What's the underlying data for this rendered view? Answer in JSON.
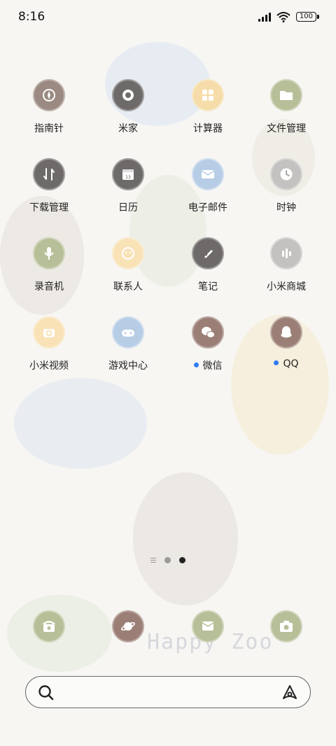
{
  "status_bar": {
    "time": "8:16",
    "battery": "100"
  },
  "apps": [
    {
      "label": "指南针",
      "icon": "compass-icon",
      "color": "#9b8a82"
    },
    {
      "label": "米家",
      "icon": "mijia-icon",
      "color": "#6e6a69"
    },
    {
      "label": "计算器",
      "icon": "calculator-icon",
      "color": "#f5dca8"
    },
    {
      "label": "文件管理",
      "icon": "folder-icon",
      "color": "#b7bf98"
    },
    {
      "label": "下载管理",
      "icon": "download-icon",
      "color": "#6e6a69"
    },
    {
      "label": "日历",
      "icon": "calendar-icon",
      "color": "#6e6a69",
      "calendar_day": "13"
    },
    {
      "label": "电子邮件",
      "icon": "mail-icon",
      "color": "#b7cde6"
    },
    {
      "label": "时钟",
      "icon": "clock-icon",
      "color": "#c4c2c0"
    },
    {
      "label": "录音机",
      "icon": "microphone-icon",
      "color": "#b7bf98"
    },
    {
      "label": "联系人",
      "icon": "contacts-icon",
      "color": "#f8e2b6"
    },
    {
      "label": "笔记",
      "icon": "notes-icon",
      "color": "#6e6a69"
    },
    {
      "label": "小米商城",
      "icon": "store-icon",
      "color": "#c4c2c0"
    },
    {
      "label": "小米视频",
      "icon": "video-icon",
      "color": "#f8e2b6"
    },
    {
      "label": "游戏中心",
      "icon": "gamepad-icon",
      "color": "#b7cde6"
    },
    {
      "label": "微信",
      "icon": "wechat-icon",
      "color": "#9b7f76",
      "new_dot": true
    },
    {
      "label": "QQ",
      "icon": "qq-icon",
      "color": "#9b7f76",
      "new_dot": true
    }
  ],
  "dock": [
    {
      "name": "phone",
      "icon": "phone-icon",
      "color": "#b7bf98"
    },
    {
      "name": "browser",
      "icon": "planet-icon",
      "color": "#9b7f76"
    },
    {
      "name": "messages",
      "icon": "message-icon",
      "color": "#b7bf98"
    },
    {
      "name": "camera",
      "icon": "camera-icon",
      "color": "#b7bf98"
    }
  ],
  "wallpaper_text": "Happy Zoo",
  "page_indicator": {
    "pages": 2,
    "current": 2
  },
  "search_bar": {
    "search_icon": "search-icon",
    "assistant_icon": "assistant-icon"
  }
}
